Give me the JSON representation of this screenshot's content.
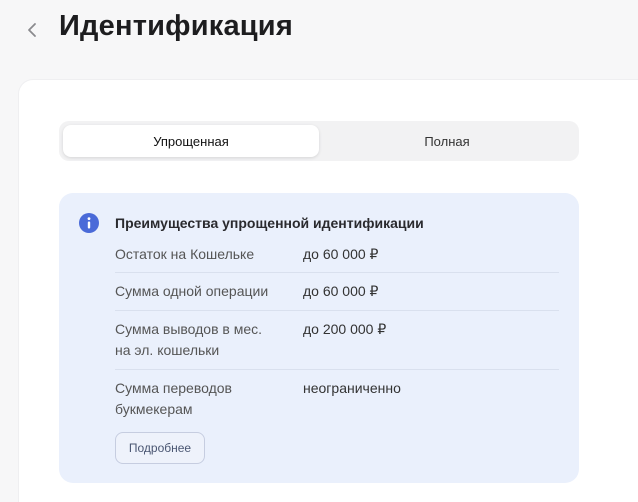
{
  "header": {
    "title": "Идентификация"
  },
  "tabs": [
    {
      "label": "Упрощенная",
      "active": true
    },
    {
      "label": "Полная",
      "active": false
    }
  ],
  "info": {
    "title": "Преимущества упрощенной идентификации",
    "rows": [
      {
        "label": "Остаток на Кошельке",
        "value": "до 60 000 ₽"
      },
      {
        "label": "Сумма одной операции",
        "value": "до 60 000 ₽"
      },
      {
        "label_line1": "Сумма выводов в мес.",
        "label_line2": "на эл. кошельки",
        "value": "до 200 000 ₽"
      },
      {
        "label_line1": "Сумма переводов",
        "label_line2": "букмекерам",
        "value": "неограниченно"
      }
    ],
    "more_label": "Подробнее"
  },
  "colors": {
    "accent": "#4a6ad8",
    "panel_bg": "#eaf0fc"
  },
  "icons": {
    "back": "chevron-left-icon",
    "info": "info-icon"
  }
}
